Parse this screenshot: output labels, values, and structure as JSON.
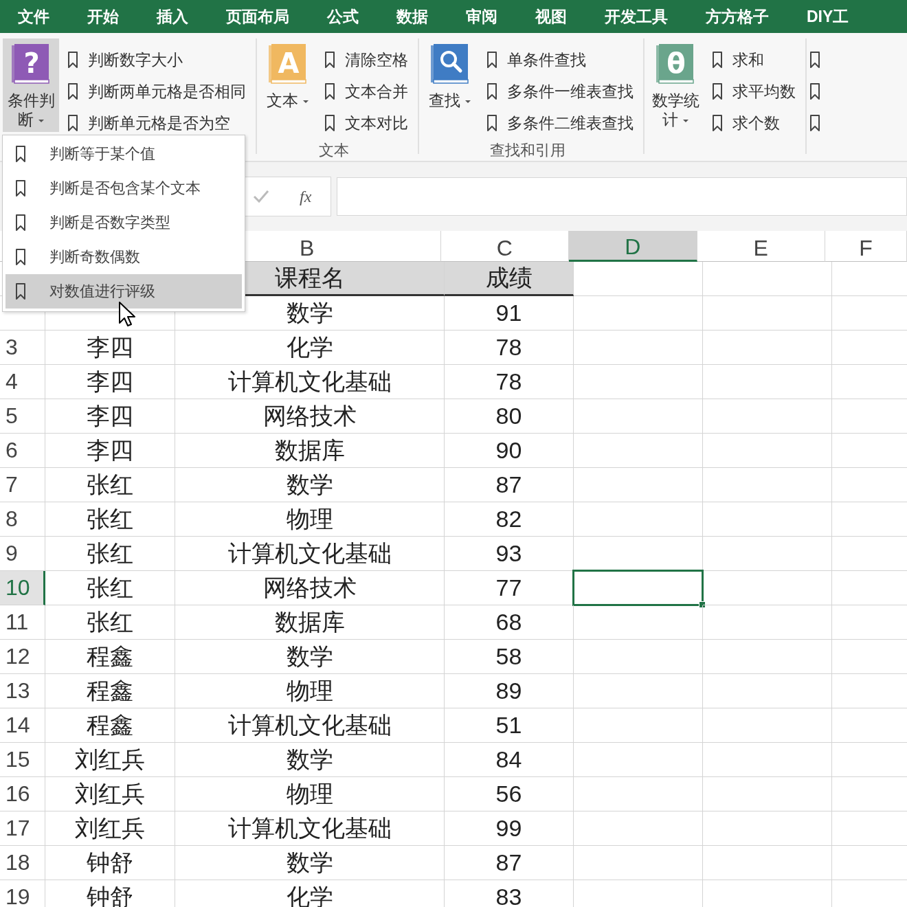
{
  "tabs": [
    {
      "label": "文件"
    },
    {
      "label": "开始"
    },
    {
      "label": "插入"
    },
    {
      "label": "页面布局"
    },
    {
      "label": "公式"
    },
    {
      "label": "数据"
    },
    {
      "label": "审阅"
    },
    {
      "label": "视图"
    },
    {
      "label": "开发工具"
    },
    {
      "label": "方方格子"
    },
    {
      "label": "DIY工"
    }
  ],
  "ribbon": {
    "groups": [
      {
        "big": {
          "label": "条件判断",
          "pressed": true,
          "icon": {
            "kind": "glyph",
            "glyph": "?",
            "color": "#8e5ab5"
          }
        },
        "items": [
          {
            "kind": "bookmark",
            "label": "判断数字大小"
          },
          {
            "kind": "bookmark",
            "label": "判断两单元格是否相同"
          },
          {
            "kind": "bookmark",
            "label": "判断单元格是否为空"
          }
        ]
      },
      {
        "label": "文本",
        "big": {
          "label": "文本",
          "pressed": false,
          "icon": {
            "kind": "glyph",
            "glyph": "A",
            "color": "#f0b860"
          }
        },
        "items": [
          {
            "kind": "bookmark",
            "label": "清除空格"
          },
          {
            "kind": "bookmark",
            "label": "文本合并"
          },
          {
            "kind": "bookmark",
            "label": "文本对比"
          }
        ]
      },
      {
        "label": "查找和引用",
        "big": {
          "label": "查找",
          "pressed": false,
          "icon": {
            "kind": "search",
            "color": "#3f7cc4"
          }
        },
        "items": [
          {
            "kind": "bookmark",
            "label": "单条件查找"
          },
          {
            "kind": "bookmark",
            "label": "多条件一维表查找"
          },
          {
            "kind": "bookmark",
            "label": "多条件二维表查找"
          }
        ]
      },
      {
        "big": {
          "label": "数学统计",
          "pressed": false,
          "icon": {
            "kind": "glyph",
            "glyph": "θ",
            "color": "#6aa58c"
          }
        },
        "items": [
          {
            "kind": "bookmark",
            "label": "求和"
          },
          {
            "kind": "bookmark",
            "label": "求平均数"
          },
          {
            "kind": "bookmark",
            "label": "求个数"
          }
        ]
      },
      {
        "items": [
          {
            "kind": "icon"
          },
          {
            "kind": "icon"
          },
          {
            "kind": "icon"
          }
        ]
      }
    ]
  },
  "dropdown": {
    "items": [
      {
        "label": "判断等于某个值",
        "selected": false
      },
      {
        "label": "判断是否包含某个文本",
        "selected": false
      },
      {
        "label": "判断是否数字类型",
        "selected": false
      },
      {
        "label": "判断奇数偶数",
        "selected": false
      },
      {
        "label": "对数值进行评级",
        "selected": true
      }
    ]
  },
  "formula_bar": {
    "function_label": "fx"
  },
  "sheet": {
    "columns": [
      {
        "label": "B",
        "selected": false
      },
      {
        "label": "C",
        "selected": false
      },
      {
        "label": "D",
        "selected": true
      },
      {
        "label": "E",
        "selected": false
      },
      {
        "label": "F",
        "selected": false
      }
    ],
    "rows": [
      {
        "kind": "header",
        "course": "课程名",
        "score": "成绩"
      },
      {
        "course": "数学",
        "score": "91"
      },
      {
        "number": "3",
        "name": "李四",
        "course": "化学",
        "score": "78",
        "selected": false
      },
      {
        "number": "4",
        "name": "李四",
        "course": "计算机文化基础",
        "score": "78",
        "selected": false
      },
      {
        "number": "5",
        "name": "李四",
        "course": "网络技术",
        "score": "80",
        "selected": false
      },
      {
        "number": "6",
        "name": "李四",
        "course": "数据库",
        "score": "90",
        "selected": false
      },
      {
        "number": "7",
        "name": "张红",
        "course": "数学",
        "score": "87",
        "selected": false
      },
      {
        "number": "8",
        "name": "张红",
        "course": "物理",
        "score": "82",
        "selected": false
      },
      {
        "number": "9",
        "name": "张红",
        "course": "计算机文化基础",
        "score": "93",
        "selected": false
      },
      {
        "number": "10",
        "name": "张红",
        "course": "网络技术",
        "score": "77",
        "selected": true
      },
      {
        "number": "11",
        "name": "张红",
        "course": "数据库",
        "score": "68",
        "selected": false
      },
      {
        "number": "12",
        "name": "程鑫",
        "course": "数学",
        "score": "58",
        "selected": false
      },
      {
        "number": "13",
        "name": "程鑫",
        "course": "物理",
        "score": "89",
        "selected": false
      },
      {
        "number": "14",
        "name": "程鑫",
        "course": "计算机文化基础",
        "score": "51",
        "selected": false
      },
      {
        "number": "15",
        "name": "刘红兵",
        "course": "数学",
        "score": "84",
        "selected": false
      },
      {
        "number": "16",
        "name": "刘红兵",
        "course": "物理",
        "score": "56",
        "selected": false
      },
      {
        "number": "17",
        "name": "刘红兵",
        "course": "计算机文化基础",
        "score": "99",
        "selected": false
      },
      {
        "number": "18",
        "name": "钟舒",
        "course": "数学",
        "score": "87",
        "selected": false
      },
      {
        "number": "19",
        "name": "钟舒",
        "course": "化学",
        "score": "83",
        "selected": false
      }
    ]
  }
}
